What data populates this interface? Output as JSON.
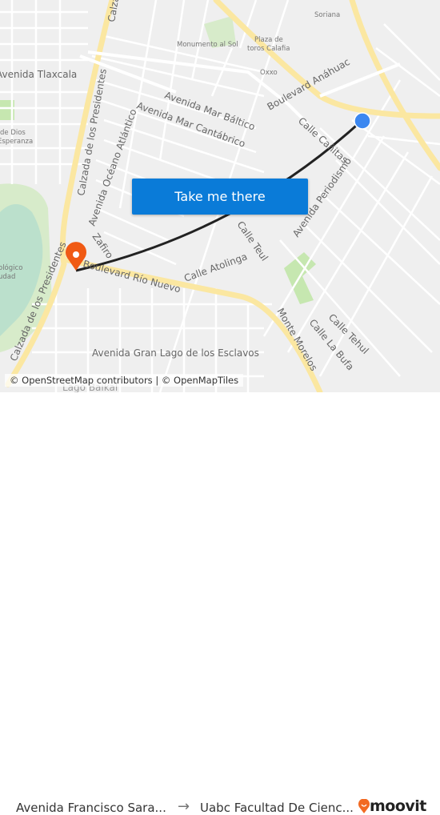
{
  "map": {
    "street_labels": [
      "Avenida Tlaxcala",
      "Calzada de los Presidentes",
      "Avenida Mar Báltico",
      "Avenida Mar Cantábrico",
      "Boulevard Anáhuac",
      "Calle Cañitas",
      "Avenida Periodismo",
      "Calle Teul",
      "Calle Atolinga",
      "Boulevard Río Nuevo",
      "Avenida Océano Atlántico",
      "Zafiro",
      "Calzada de los Presidentes",
      "Monte Morelos",
      "Calle La Bufa",
      "Calle Tehul",
      "Avenida Gran Lago de los Esclavos",
      "Calza",
      "Lago Baikal"
    ],
    "poi_labels": [
      "Soriana",
      "Monumento al Sol",
      "Plaza de",
      "toros Calafia",
      "Oxxo",
      "de Dios",
      "Esperanza",
      "ológico",
      "udad"
    ],
    "colors": {
      "route": "#222222",
      "origin": "#3b87f0",
      "destination": "#f05a14",
      "major_road": "#fbe7a1",
      "park": "#c6e7b0",
      "water": "#aad4f5"
    }
  },
  "cta": {
    "label": "Take me there",
    "color": "#0a7bd8"
  },
  "attribution": "© OpenStreetMap contributors | © OpenMapTiles",
  "footer": {
    "from": "Avenida Francisco Sara...",
    "arrow": "→",
    "to": "Uabc Facultad De Cienc...",
    "brand": "moovit",
    "brand_color": "#f26a22"
  }
}
